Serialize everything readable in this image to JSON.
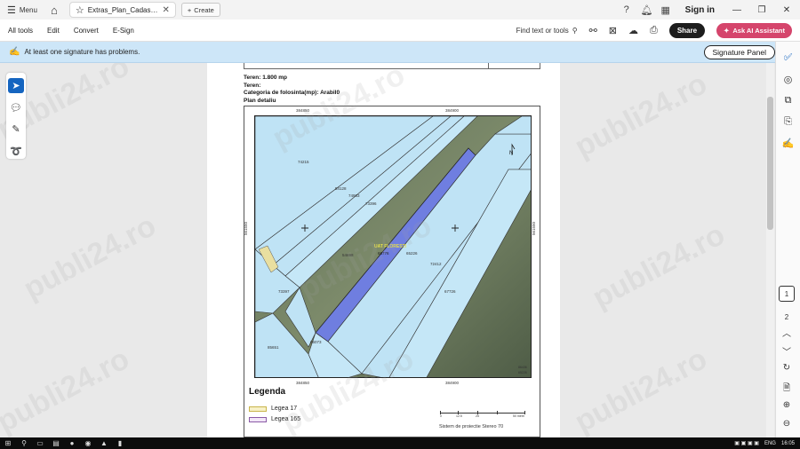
{
  "titlebar": {
    "menu_label": "Menu",
    "tab_title": "Extras_Plan_Cadastral_...",
    "create_label": "Create",
    "sign_in": "Sign in"
  },
  "toolbar": {
    "menus": [
      "All tools",
      "Edit",
      "Convert",
      "E-Sign"
    ],
    "find_text": "Find text or tools",
    "share_label": "Share",
    "ai_label": "Ask AI Assistant"
  },
  "signature_bar": {
    "message": "At least one signature has problems.",
    "panel_button": "Signature Panel"
  },
  "document": {
    "teren_line": "Teren:   1.800 mp",
    "teren2": "Teren:",
    "folosinta": "Categoria de folosinta(mp): Arabil0",
    "plan_detaliu": "Plan detaliu",
    "coords": {
      "top_left": "384850",
      "top_right": "384900",
      "bottom_left": "384850",
      "bottom_right": "384900",
      "side_left": "561550",
      "side_right": "561550"
    },
    "parcels": [
      "74215",
      "54128",
      "74983",
      "73396",
      "54698",
      "68776",
      "65226",
      "72412",
      "67726",
      "73397",
      "66073",
      "85651"
    ],
    "uat_label": "UAT FLORESTI",
    "north": "N",
    "corner_labels": [
      "86436",
      "65226"
    ],
    "legend": {
      "title": "Legenda",
      "items": [
        {
          "label": "Legea 17",
          "color": "#e8d98a"
        },
        {
          "label": "Legea 165",
          "color": "#b58bc7"
        }
      ]
    },
    "scale_labels": [
      "0",
      "12.5",
      "25",
      "",
      "50 metri"
    ],
    "projection": "Sistem de proiectie Stereo 70"
  },
  "watermark_text": "publi24.ro",
  "page_numbers": [
    "1",
    "2"
  ],
  "tray": {
    "lang": "ENG",
    "time": "16:05"
  }
}
